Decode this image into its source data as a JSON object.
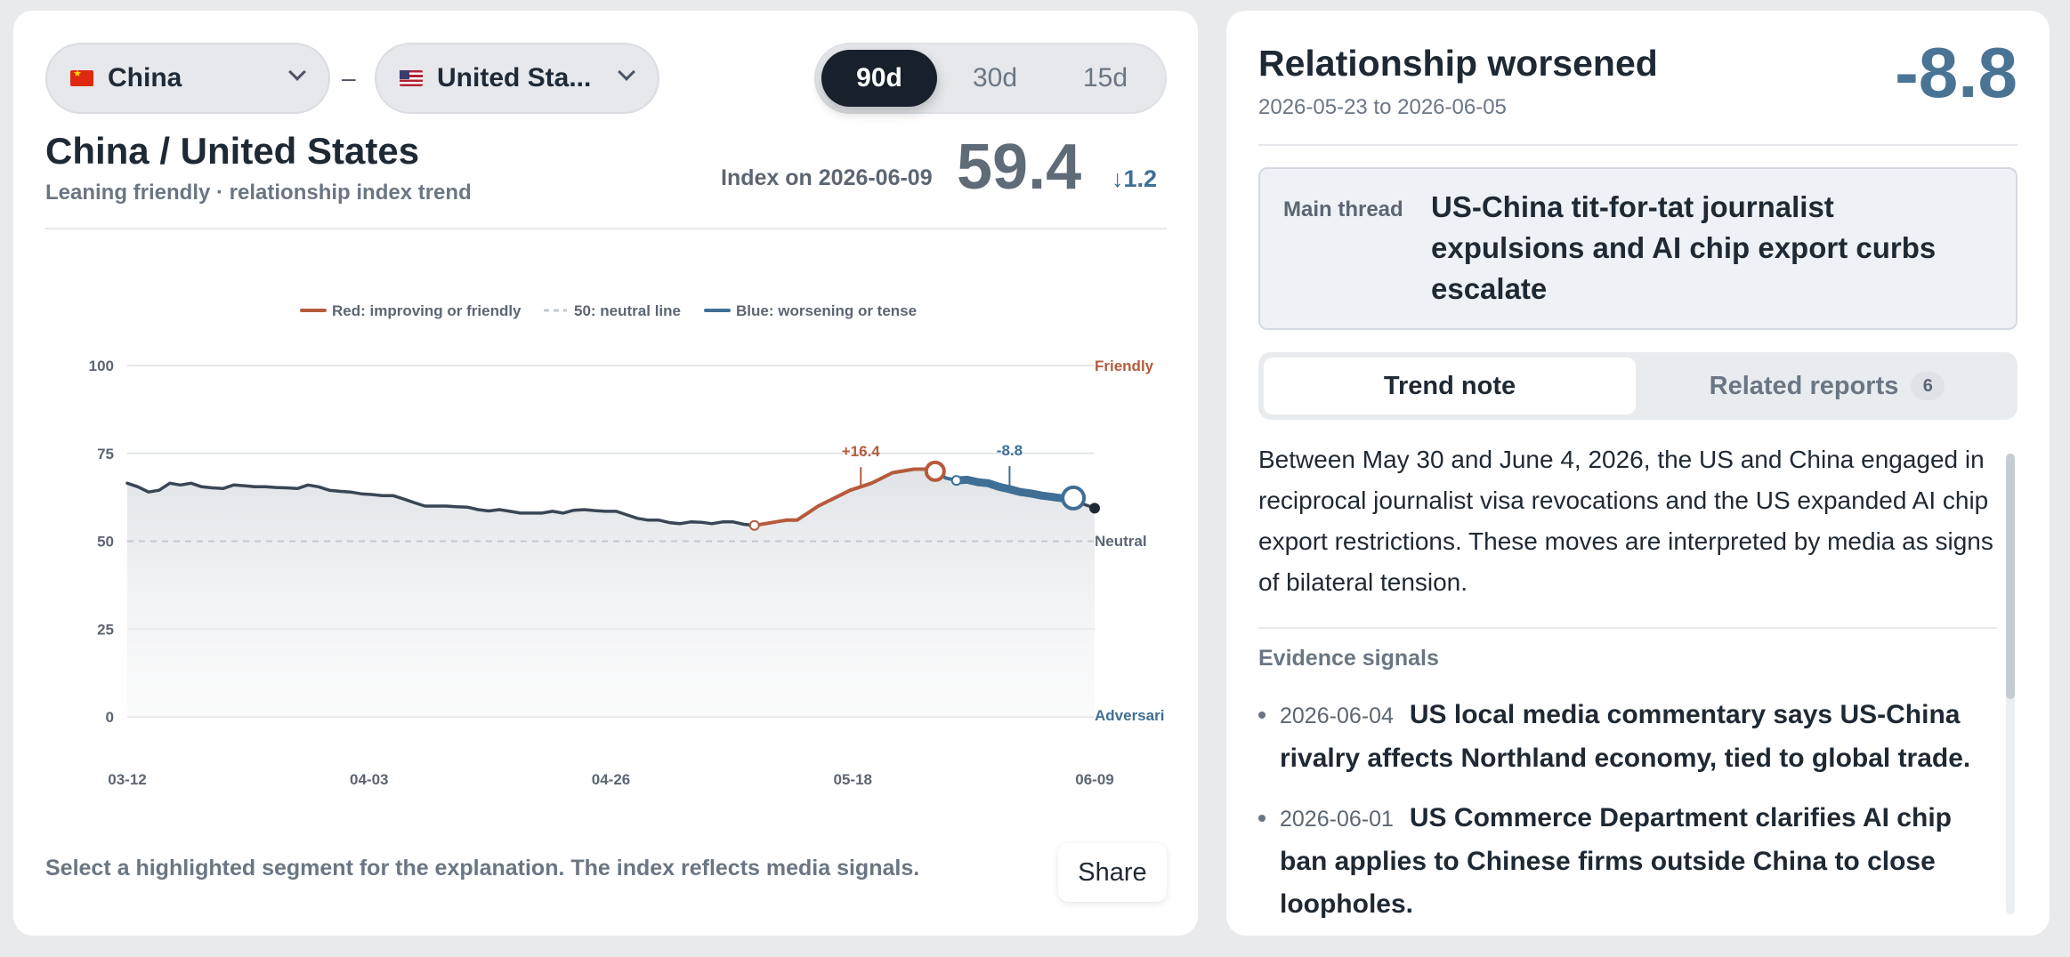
{
  "countries": {
    "a": {
      "label": "China",
      "flag": "cn-flag-icon"
    },
    "b": {
      "label": "United Sta...",
      "flag": "us-flag-icon"
    },
    "separator": "–"
  },
  "range": {
    "options": [
      "90d",
      "30d",
      "15d"
    ],
    "selected": "90d"
  },
  "header": {
    "title": "China / United States",
    "subtitle": "Leaning friendly · relationship index trend",
    "index_label": "Index on 2026-06-09",
    "index_value": "59.4",
    "index_change": "↓1.2"
  },
  "legend": {
    "red": "Red: improving or friendly",
    "neutral": "50: neutral line",
    "blue": "Blue: worsening or tense"
  },
  "colors": {
    "improving": "#b55b3b",
    "worsening": "#3f6f95",
    "base_line": "#3a4654",
    "neutral_line": "#c4c9cf"
  },
  "chart_data": {
    "type": "line",
    "x_ticks": [
      "03-12",
      "04-03",
      "04-26",
      "05-18",
      "06-09"
    ],
    "y_ticks": [
      0,
      25,
      50,
      75,
      100
    ],
    "ylim": [
      0,
      100
    ],
    "zone_labels": {
      "top": "Friendly",
      "middle": "Neutral",
      "bottom": "Adversari"
    },
    "neutral_value": 50,
    "values": [
      66.5,
      65.5,
      64,
      64.5,
      66.5,
      66,
      66.5,
      65.5,
      65.2,
      65,
      66,
      65.8,
      65.5,
      65.5,
      65.3,
      65.2,
      65,
      66,
      65.5,
      64.5,
      64.2,
      64,
      63.5,
      63.3,
      63,
      63,
      62,
      61,
      60,
      60,
      60,
      59.8,
      59.7,
      59,
      58.6,
      59,
      58.5,
      58,
      58,
      58,
      58.5,
      58,
      58.8,
      59,
      58.7,
      58.5,
      58.5,
      57.5,
      56.5,
      56,
      56,
      55.3,
      55,
      55.5,
      55.4,
      55,
      55.5,
      55.5,
      54.8,
      54.5,
      55,
      55.5,
      56,
      56,
      58,
      60,
      61.5,
      63,
      64.5,
      65.5,
      66.5,
      68,
      69.5,
      70,
      70.5,
      70.5,
      69.9,
      68,
      67.3,
      67.5,
      66.8,
      66.5,
      65.5,
      64.8,
      64,
      63.6,
      63,
      62.6,
      62.2,
      62.3,
      60.5,
      59.4
    ],
    "highlights": [
      {
        "label": "+16.4",
        "direction": "improving",
        "start_index": 59,
        "end_index": 76
      },
      {
        "label": "-8.8",
        "direction": "worsening",
        "start_index": 76,
        "end_index": 89
      }
    ]
  },
  "footer": {
    "note": "Select a highlighted segment for the explanation. The index reflects media signals.",
    "share_label": "Share"
  },
  "detail": {
    "title": "Relationship worsened",
    "date_range": "2026-05-23 to 2026-06-05",
    "delta": "-8.8",
    "thread_label": "Main thread",
    "thread_title": "US-China tit-for-tat journalist expulsions and AI chip export curbs escalate",
    "tabs": [
      {
        "label": "Trend note",
        "active": true
      },
      {
        "label": "Related reports",
        "count": "6",
        "active": false
      }
    ],
    "trend_note": "Between May 30 and June 4, 2026, the US and China engaged in reciprocal journalist visa revocations and the US expanded AI chip export restrictions. These moves are interpreted by media as signs of bilateral tension.",
    "evidence_heading": "Evidence signals",
    "evidence": [
      {
        "date": "2026-06-04",
        "text": "US local media commentary says US-China rivalry affects Northland economy, tied to global trade."
      },
      {
        "date": "2026-06-01",
        "text": "US Commerce Department clarifies AI chip ban applies to Chinese firms outside China to close loopholes."
      }
    ]
  }
}
